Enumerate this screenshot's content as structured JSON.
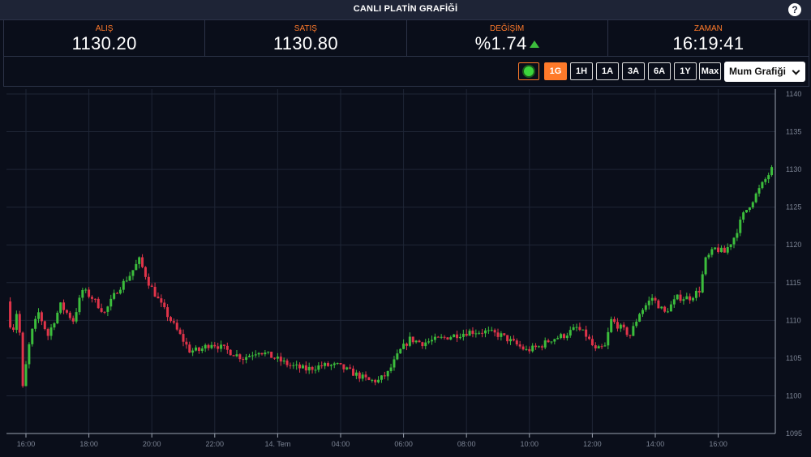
{
  "header": {
    "title": "CANLI PLATİN GRAFİĞİ",
    "help_symbol": "?"
  },
  "stats": {
    "bid_label": "ALIŞ",
    "bid_value": "1130.20",
    "ask_label": "SATIŞ",
    "ask_value": "1130.80",
    "change_label": "DEĞİŞİM",
    "change_value": "%1.74",
    "time_label": "ZAMAN",
    "time_value": "16:19:41"
  },
  "controls": {
    "ranges": [
      "1G",
      "1H",
      "1A",
      "3A",
      "6A",
      "1Y",
      "Max"
    ],
    "active_range": "1G",
    "chart_type": "Mum Grafiği"
  },
  "colors": {
    "up": "#3cbd3c",
    "down": "#e0344a",
    "accent": "#ff7a2a"
  },
  "chart_data": {
    "type": "candlestick",
    "ylim": [
      1095,
      1140
    ],
    "y_ticks": [
      "1095",
      "1100",
      "1105",
      "1110",
      "1115",
      "1120",
      "1125",
      "1130",
      "1135",
      "1140"
    ],
    "x_ticks": [
      "16:00",
      "18:00",
      "20:00",
      "22:00",
      "14. Tem",
      "04:00",
      "06:00",
      "08:00",
      "10:00",
      "12:00",
      "14:00",
      "16:00"
    ],
    "x_range_hours": [
      -0.5,
      24.3
    ],
    "price_path": [
      [
        -0.5,
        1112.5
      ],
      [
        -0.35,
        1108
      ],
      [
        -0.15,
        1112
      ],
      [
        0.0,
        1101
      ],
      [
        0.1,
        1104
      ],
      [
        0.25,
        1108
      ],
      [
        0.5,
        1111
      ],
      [
        0.8,
        1108
      ],
      [
        1.2,
        1112
      ],
      [
        1.6,
        1110
      ],
      [
        1.9,
        1114
      ],
      [
        2.2,
        1113
      ],
      [
        2.6,
        1111
      ],
      [
        3.0,
        1114
      ],
      [
        3.4,
        1116
      ],
      [
        3.7,
        1118
      ],
      [
        4.0,
        1115
      ],
      [
        4.4,
        1112
      ],
      [
        4.7,
        1110
      ],
      [
        5.0,
        1108
      ],
      [
        5.3,
        1106
      ],
      [
        5.6,
        1106
      ],
      [
        6.0,
        1107
      ],
      [
        6.5,
        1106
      ],
      [
        7.0,
        1105
      ],
      [
        7.5,
        1106
      ],
      [
        8.0,
        1105
      ],
      [
        8.5,
        1104
      ],
      [
        9.0,
        1103.5
      ],
      [
        9.5,
        1104
      ],
      [
        10.0,
        1104
      ],
      [
        10.5,
        1103
      ],
      [
        11.0,
        1102
      ],
      [
        11.3,
        1102
      ],
      [
        11.6,
        1103
      ],
      [
        12.0,
        1106
      ],
      [
        12.3,
        1107.5
      ],
      [
        12.7,
        1107
      ],
      [
        13.2,
        1107.5
      ],
      [
        13.7,
        1108
      ],
      [
        14.2,
        1108.5
      ],
      [
        14.7,
        1108.5
      ],
      [
        15.2,
        1108
      ],
      [
        15.6,
        1107
      ],
      [
        16.0,
        1106
      ],
      [
        16.4,
        1106.5
      ],
      [
        16.8,
        1107.5
      ],
      [
        17.2,
        1108
      ],
      [
        17.6,
        1109
      ],
      [
        17.9,
        1108
      ],
      [
        18.2,
        1106
      ],
      [
        18.5,
        1106.5
      ],
      [
        18.7,
        1110
      ],
      [
        19.0,
        1109
      ],
      [
        19.3,
        1108
      ],
      [
        19.6,
        1111
      ],
      [
        20.0,
        1113
      ],
      [
        20.4,
        1111
      ],
      [
        20.8,
        1113
      ],
      [
        21.2,
        1113
      ],
      [
        21.5,
        1114
      ],
      [
        21.7,
        1118
      ],
      [
        22.0,
        1119.5
      ],
      [
        22.3,
        1119
      ],
      [
        22.6,
        1121
      ],
      [
        22.9,
        1124
      ],
      [
        23.2,
        1126
      ],
      [
        23.5,
        1128
      ],
      [
        23.8,
        1130
      ],
      [
        24.0,
        1132.5
      ],
      [
        24.15,
        1134
      ],
      [
        24.3,
        1130.5
      ]
    ]
  }
}
